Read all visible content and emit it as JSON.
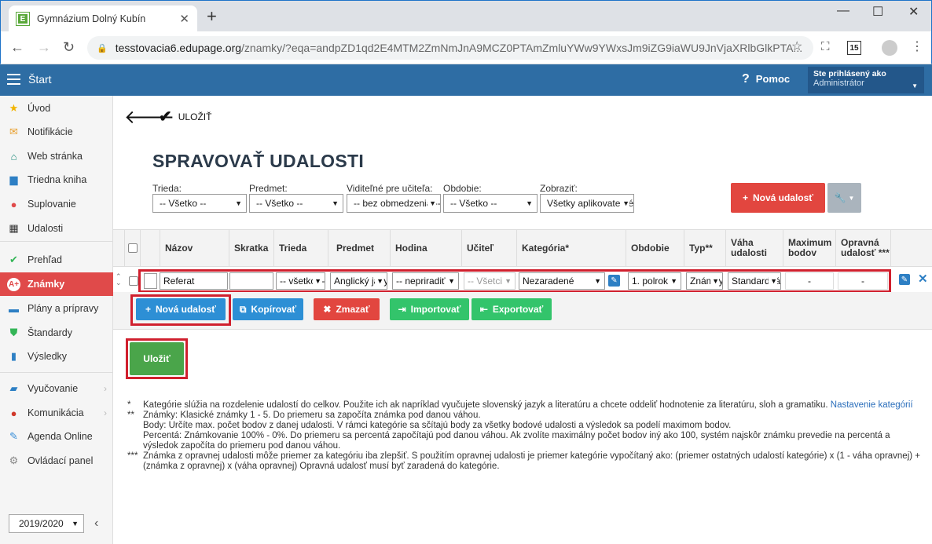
{
  "browser": {
    "tab_title": "Gymnázium Dolný Kubín",
    "favicon_letter": "E",
    "url_host": "tesstovacia6.edupage.org",
    "url_path": "/znamky/?eqa=andpZD1qd2E4MTM2ZmNmJnA9MCZ0PTAmZmluYWw9YWxsJm9iZG9iaWU9JnVjaXRlbGlkPTA...",
    "ext_badge": "15"
  },
  "header": {
    "start_label": "Štart",
    "help_label": "Pomoc",
    "user_line1": "Ste prihlásený ako",
    "user_line2": "Administrátor"
  },
  "sidebar": {
    "items": [
      {
        "label": "Úvod",
        "icon": "star-icon"
      },
      {
        "label": "Notifikácie",
        "icon": "envelope-icon"
      },
      {
        "label": "Web stránka",
        "icon": "home-icon"
      },
      {
        "label": "Triedna kniha",
        "icon": "book-icon"
      },
      {
        "label": "Suplovanie",
        "icon": "person-icon"
      },
      {
        "label": "Udalosti",
        "icon": "calendar-icon"
      },
      {
        "label": "Prehľad",
        "icon": "check-circle-icon"
      },
      {
        "label": "Známky",
        "icon": "grade-icon"
      },
      {
        "label": "Plány a prípravy",
        "icon": "briefcase-icon"
      },
      {
        "label": "Štandardy",
        "icon": "shield-icon"
      },
      {
        "label": "Výsledky",
        "icon": "bar-chart-icon"
      },
      {
        "label": "Vyučovanie",
        "icon": "book-open-icon"
      },
      {
        "label": "Komunikácia",
        "icon": "chat-icon"
      },
      {
        "label": "Agenda Online",
        "icon": "pen-icon"
      },
      {
        "label": "Ovládací panel",
        "icon": "gear-icon"
      }
    ],
    "year": "2019/2020"
  },
  "toolbar": {
    "save_label": "ULOŽIŤ"
  },
  "page": {
    "title": "Spravovať udalosti"
  },
  "filters": {
    "trieda_label": "Trieda:",
    "trieda_value": "-- Všetko --",
    "predmet_label": "Predmet:",
    "predmet_value": "-- Všetko --",
    "viditelne_label": "Viditeľné pre učiteľa:",
    "viditelne_value": "-- bez obmedzenia --",
    "obdobie_label": "Obdobie:",
    "obdobie_value": "-- Všetko --",
    "zobrazit_label": "Zobraziť:",
    "zobrazit_value": "Všetky aplikovateľné"
  },
  "buttons": {
    "nova_udalost_top": "Nová udalosť",
    "nova_udalost": "Nová udalosť",
    "kopirovat": "Kopírovať",
    "zmazat": "Zmazať",
    "importovat": "Importovať",
    "exportovat": "Exportovať",
    "ulozit": "Uložiť"
  },
  "table": {
    "headers": {
      "nazov": "Názov",
      "skratka": "Skratka",
      "trieda": "Trieda",
      "predmet": "Predmet",
      "hodina": "Hodina",
      "ucitel": "Učiteľ",
      "kategoria": "Kategória*",
      "obdobie": "Obdobie",
      "typ": "Typ**",
      "vaha": "Váha udalosti",
      "maximum": "Maximum bodov",
      "opravna": "Opravná udalosť ***"
    },
    "row": {
      "nazov": "Referat",
      "skratka": "",
      "trieda": "-- všetko --",
      "predmet": "Anglický jazyk",
      "hodina": "-- nepriradiť --",
      "ucitel": "-- Všetci --",
      "kategoria": "Nezaradené",
      "obdobie": "1. polrok",
      "typ": "Známky",
      "vaha": "Standardná",
      "maximum": "-",
      "opravna": "-"
    }
  },
  "footnotes": {
    "f1_mark": "*",
    "f1_text": "Kategórie slúžia na rozdelenie udalostí do celkov. Použite ich ak napríklad vyučujete slovenský jazyk a literatúru a chcete oddeliť hodnotenie za literatúru, sloh a gramatiku.",
    "f1_link": "Nastavenie kategórií",
    "f2_mark": "**",
    "f2_l1": "Známky: Klasické známky 1 - 5. Do priemeru sa započíta známka pod danou váhou.",
    "f2_l2": "Body: Určíte max. počet bodov z danej udalosti. V rámci kategórie sa sčítajú body za všetky bodové udalosti a výsledok sa podelí maximom bodov.",
    "f2_l3": "Percentá: Známkovanie 100% - 0%. Do priemeru sa percentá započítajú pod danou váhou. Ak zvolíte maximálny počet bodov iný ako 100, systém najskôr známku prevedie na percentá a výsledok započíta do priemeru pod danou váhou.",
    "f3_mark": "***",
    "f3_text": "Známka z opravnej udalosti môže priemer za kategóriu iba zlepšiť. S použitím opravnej udalosti je priemer kategórie vypočítaný ako: (priemer ostatných udalostí kategórie) x (1 - váha opravnej) + (známka z opravnej) x (váha opravnej) Opravná udalosť musí byť zaradená do kategórie."
  },
  "colors": {
    "header": "#2e6da4",
    "active": "#e04a4a",
    "highlight": "#d0202e"
  }
}
